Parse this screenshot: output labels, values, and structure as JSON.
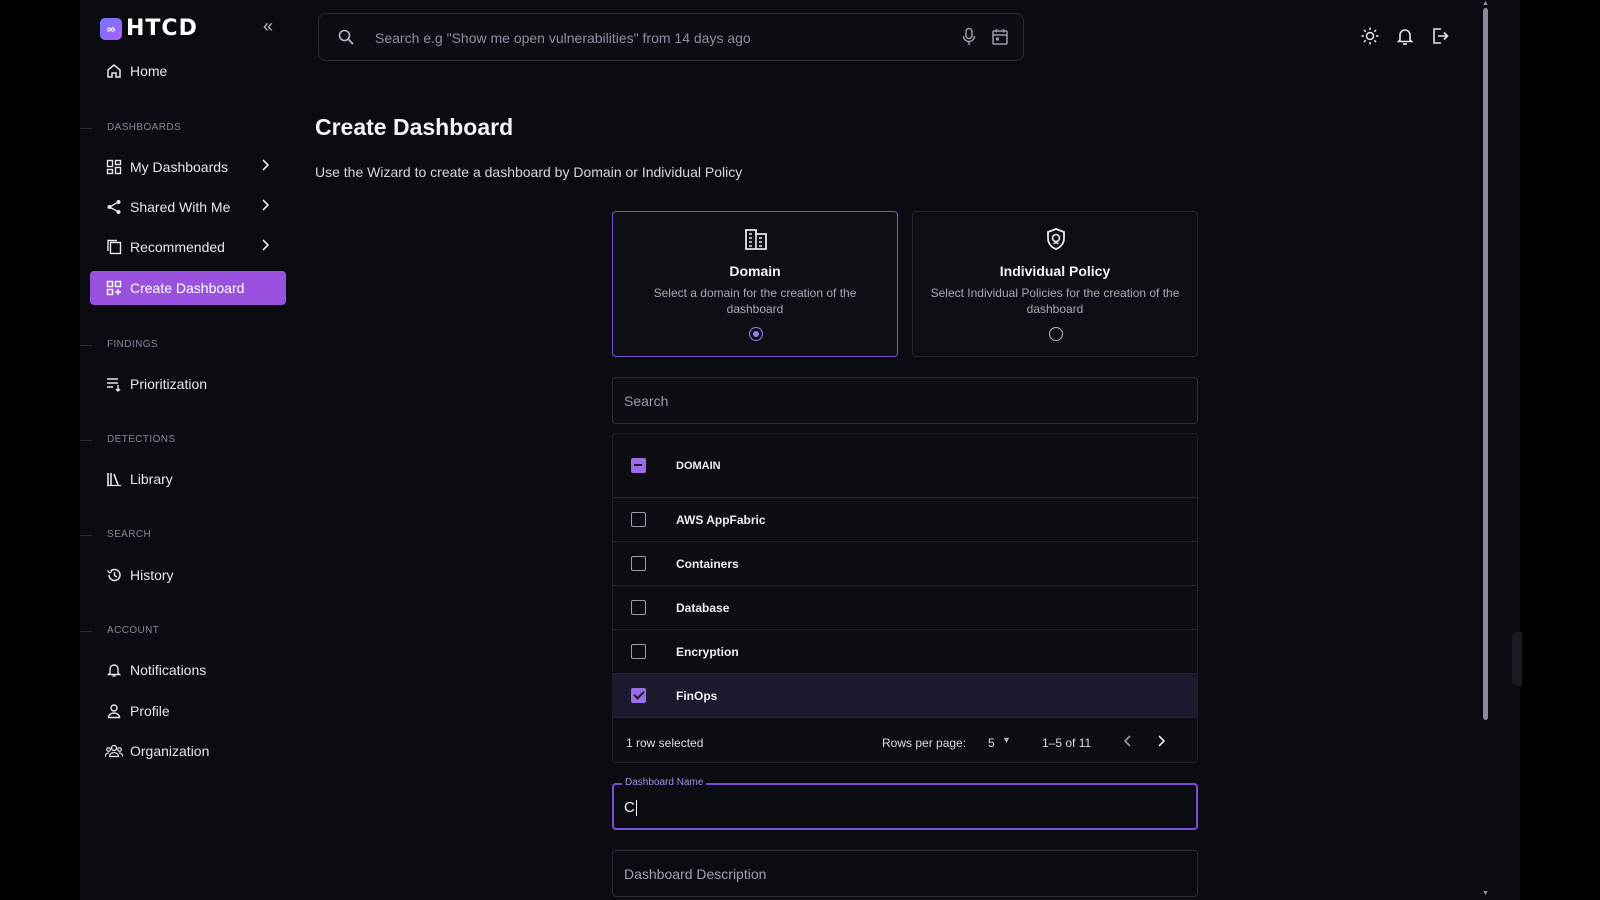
{
  "app": {
    "logo_text": "HTCD"
  },
  "top_search": {
    "placeholder": "Search e.g \"Show me open vulnerabilities\" from 14 days ago"
  },
  "sidebar": {
    "home": "Home",
    "sections": {
      "dashboards": "DASHBOARDS",
      "findings": "FINDINGS",
      "detections": "DETECTIONS",
      "search": "SEARCH",
      "account": "ACCOUNT"
    },
    "items": {
      "my_dashboards": "My Dashboards",
      "shared_with_me": "Shared With Me",
      "recommended": "Recommended",
      "create_dashboard": "Create Dashboard",
      "prioritization": "Prioritization",
      "library": "Library",
      "history": "History",
      "notifications": "Notifications",
      "profile": "Profile",
      "organization": "Organization"
    }
  },
  "main": {
    "title": "Create Dashboard",
    "subtitle": "Use the Wizard to create a dashboard by Domain or Individual Policy",
    "cards": [
      {
        "title": "Domain",
        "description": "Select a domain for the creation of the dashboard",
        "selected": true
      },
      {
        "title": "Individual Policy",
        "description": "Select Individual Policies for the creation of the dashboard",
        "selected": false
      }
    ],
    "list_search_placeholder": "Search",
    "table": {
      "header": "DOMAIN",
      "rows": [
        {
          "name": "AWS AppFabric",
          "checked": false
        },
        {
          "name": "Containers",
          "checked": false
        },
        {
          "name": "Database",
          "checked": false
        },
        {
          "name": "Encryption",
          "checked": false
        },
        {
          "name": "FinOps",
          "checked": true
        }
      ],
      "selected_text": "1 row selected",
      "rows_per_page_label": "Rows per page:",
      "rows_per_page_value": "5",
      "range_text": "1–5 of 11"
    },
    "dashboard_name": {
      "label": "Dashboard Name",
      "value": "C"
    },
    "dashboard_description": {
      "placeholder": "Dashboard Description"
    }
  },
  "colors": {
    "accent": "#9b51e0",
    "background": "#0b0c12"
  }
}
